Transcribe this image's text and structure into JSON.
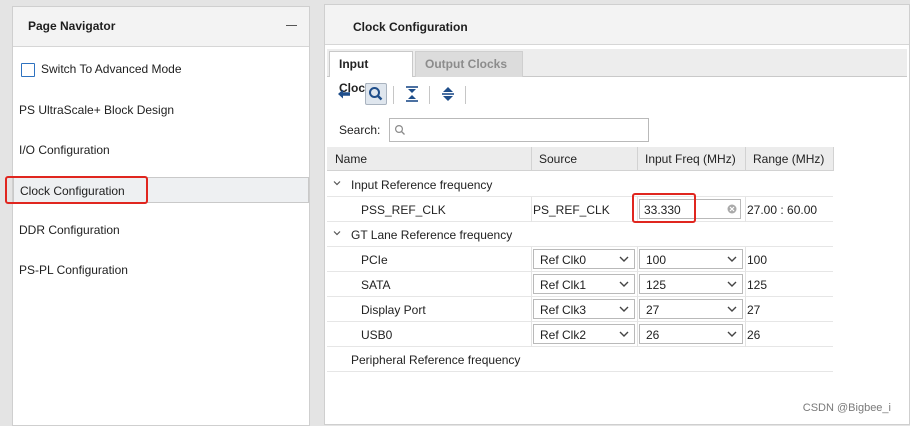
{
  "page_navigator": {
    "title": "Page Navigator",
    "advanced_mode": {
      "label": "Switch To Advanced Mode",
      "checked": false
    },
    "items": [
      {
        "label": "PS UltraScale+ Block Design"
      },
      {
        "label": "I/O Configuration"
      },
      {
        "label": "Clock Configuration",
        "selected": true
      },
      {
        "label": "DDR Configuration"
      },
      {
        "label": "PS-PL Configuration"
      }
    ]
  },
  "clock_configuration": {
    "title": "Clock Configuration",
    "tabs": [
      {
        "label": "Input Clocks",
        "active": true
      },
      {
        "label": "Output Clocks",
        "active": false
      }
    ],
    "toolbar": {
      "icons": [
        "back-arrow-icon",
        "search-icon",
        "collapse-all-icon",
        "expand-all-icon"
      ]
    },
    "search": {
      "label": "Search:",
      "placeholder": "Q-",
      "value": ""
    },
    "table": {
      "columns": [
        "Name",
        "Source",
        "Input Freq (MHz)",
        "Range (MHz)"
      ],
      "groups": [
        {
          "label": "Input Reference frequency",
          "rows": [
            {
              "name": "PSS_REF_CLK",
              "source": "PS_REF_CLK",
              "freq": "33.330",
              "range": "27.00 : 60.00"
            }
          ]
        },
        {
          "label": "GT Lane Reference frequency",
          "rows": [
            {
              "name": "PCIe",
              "source": "Ref Clk0",
              "freq": "100",
              "range": "100"
            },
            {
              "name": "SATA",
              "source": "Ref Clk1",
              "freq": "125",
              "range": "125"
            },
            {
              "name": "Display Port",
              "source": "Ref Clk3",
              "freq": "27",
              "range": "27"
            },
            {
              "name": "USB0",
              "source": "Ref Clk2",
              "freq": "26",
              "range": "26"
            }
          ]
        },
        {
          "label": "Peripheral Reference frequency",
          "rows": []
        }
      ]
    }
  },
  "watermark": "CSDN @Bigbee_i",
  "colors": {
    "accent": "#2e72c0",
    "highlight": "#e0261f"
  }
}
